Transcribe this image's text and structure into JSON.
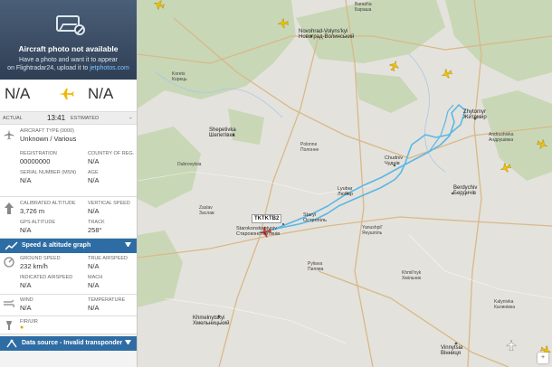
{
  "photo": {
    "title": "Aircraft photo not available",
    "line1": "Have a photo and want it to appear",
    "line2_prefix": "on Flightradar24, upload it to ",
    "line2_link": "jetphotos.com"
  },
  "route": {
    "origin": "N/A",
    "destination": "N/A",
    "actual_label": "ACTUAL",
    "actual_time": "13:41",
    "estimated_label": "ESTIMATED",
    "estimated_value": "-"
  },
  "aircraft": {
    "type_label": "AIRCRAFT TYPE",
    "type_code": "(0000)",
    "type_value": "Unknown / Various",
    "reg_label": "REGISTRATION",
    "reg_value": "00000000",
    "country_label": "COUNTRY OF REG.",
    "country_value": "N/A",
    "msn_label": "SERIAL NUMBER (MSN)",
    "msn_value": "N/A",
    "age_label": "AGE",
    "age_value": "N/A"
  },
  "position": {
    "cal_alt_label": "CALIBRATED ALTITUDE",
    "cal_alt_value": "3,726 m",
    "vspeed_label": "VERTICAL SPEED",
    "vspeed_value": "N/A",
    "gps_alt_label": "GPS ALTITUDE",
    "gps_alt_value": "N/A",
    "track_label": "TRACK",
    "track_value": "258°"
  },
  "speed_graph": {
    "label": "Speed & altitude graph"
  },
  "speed": {
    "gs_label": "GROUND SPEED",
    "gs_value": "232 km/h",
    "tas_label": "TRUE AIRSPEED",
    "tas_value": "N/A",
    "ias_label": "INDICATED AIRSPEED",
    "ias_value": "N/A",
    "mach_label": "MACH",
    "mach_value": "N/A"
  },
  "weather": {
    "wind_label": "WIND",
    "wind_value": "N/A",
    "temp_label": "TEMPERATURE",
    "temp_value": "N/A"
  },
  "fir": {
    "label": "FIR/UIR"
  },
  "data_source": {
    "label": "Data source - Invalid transponder"
  },
  "map": {
    "callsign": "TKTKTB2",
    "track_color": "#5ab7e6",
    "aircraft_color": "#f2c200",
    "selected_aircraft_color": "#d23a2a",
    "labels": {
      "barasha": "Barasha\nБараша",
      "novohrad": "Novohrad-Volyns'kyi\nНовоград-Волинський",
      "zhytomyr": "Zhytomyr\nЖитомир",
      "shepetivka": "Shepetivka\nШепетівка",
      "chudniv": "Chudniv\nЧуднів",
      "berdychiv": "Berdychiv\nБердичів",
      "lyubar": "Lyubar\nЛюбар",
      "starokostiantyniv": "Starokonstiantyniv\nСтароконстянтинів",
      "staryi_ostropil": "Staryi\nОстропіль",
      "khmelnytskyi": "Khmelnytskyi\nХмельницький",
      "vinnytsia": "Vinnytsia\nВінниця",
      "polonne": "Polonne\nПолонне",
      "dubrovytsia": "Dubrovytsia",
      "korets": "Korets\nКорець",
      "zaslav": "Zaslav\nЗаслав",
      "pyliava": "Pyliava\nПилява",
      "khmilnyk": "Khmil'nyk\nХмільник",
      "yanushpil": "Yanushpil'\nЯнушпіль",
      "kalynivka": "Kalynivka\nКалинівка",
      "andrushivka": "Andrushivka\nАндрушівка",
      "zhytomyr2": "Zhytomyr\nЖитомир"
    }
  }
}
